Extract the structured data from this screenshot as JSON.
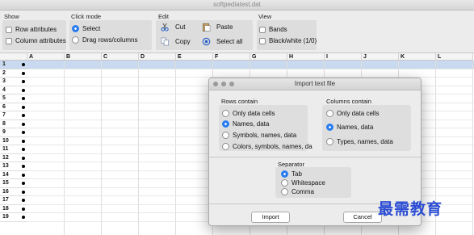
{
  "window": {
    "title": "softpediatest.dat"
  },
  "toolbar": {
    "show": {
      "title": "Show",
      "row_attributes": "Row attributes",
      "column_attributes": "Column attributes"
    },
    "click_mode": {
      "title": "Click mode",
      "select": "Select",
      "drag": "Drag rows/columns",
      "selected": "Select"
    },
    "edit": {
      "title": "Edit",
      "cut": "Cut",
      "paste": "Paste",
      "copy": "Copy",
      "select_all": "Select all"
    },
    "view": {
      "title": "View",
      "bands": "Bands",
      "black_white": "Black/white (1/0)"
    }
  },
  "sheet": {
    "columns": [
      "A",
      "B",
      "C",
      "D",
      "E",
      "F",
      "G",
      "H",
      "I",
      "J",
      "K",
      "L"
    ],
    "rows": [
      "1",
      "2",
      "3",
      "4",
      "5",
      "6",
      "7",
      "8",
      "9",
      "10",
      "11",
      "12",
      "13",
      "14",
      "15",
      "16",
      "17",
      "18",
      "19"
    ],
    "selected_row": "1"
  },
  "dialog": {
    "title": "Import text file",
    "rows_contain": {
      "label": "Rows contain",
      "options": [
        "Only data cells",
        "Names, data",
        "Symbols, names, data",
        "Colors, symbols, names, da"
      ],
      "selected": "Names, data"
    },
    "columns_contain": {
      "label": "Columns contain",
      "options": [
        "Only data cells",
        "Names, data",
        "Types, names, data"
      ],
      "selected": "Names, data"
    },
    "separator": {
      "label": "Separator",
      "options": [
        "Tab",
        "Whitespace",
        "Comma"
      ],
      "selected": "Tab"
    },
    "import_label": "Import",
    "cancel_label": "Cancel"
  },
  "watermark": "最需教育",
  "colors": {
    "accent": "#2a7df0",
    "selection": "#c9d9ef",
    "watermark": "#2b4cd3"
  }
}
